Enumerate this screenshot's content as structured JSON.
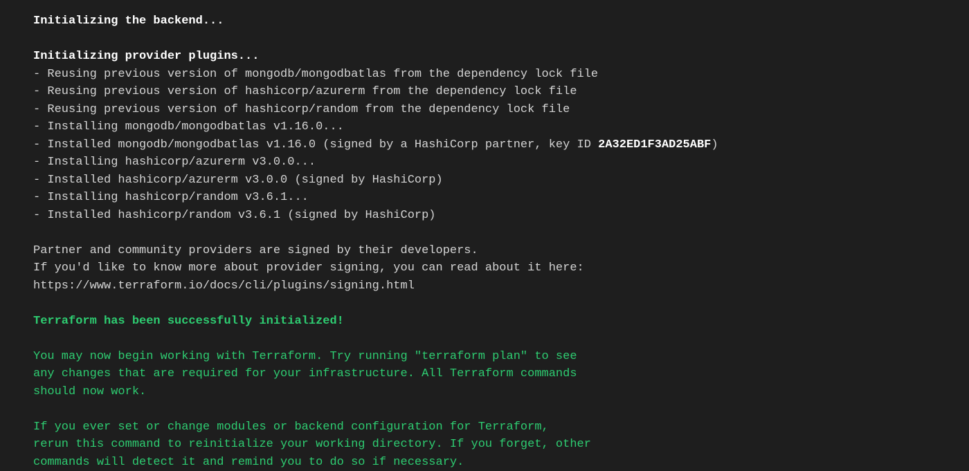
{
  "colors": {
    "success": "#2ecc71",
    "text": "#d4d4d4",
    "bg": "#1e1e1e"
  },
  "lines": {
    "init_backend": "Initializing the backend...",
    "init_plugins": "Initializing provider plugins...",
    "reuse_mongodb": "- Reusing previous version of mongodb/mongodbatlas from the dependency lock file",
    "reuse_azurerm": "- Reusing previous version of hashicorp/azurerm from the dependency lock file",
    "reuse_random": "- Reusing previous version of hashicorp/random from the dependency lock file",
    "install_mongodb": "- Installing mongodb/mongodbatlas v1.16.0...",
    "installed_mongodb_prefix": "- Installed mongodb/mongodbatlas v1.16.0 (signed by a HashiCorp partner, key ID ",
    "installed_mongodb_keyid": "2A32ED1F3AD25ABF",
    "installed_mongodb_suffix": ")",
    "install_azurerm": "- Installing hashicorp/azurerm v3.0.0...",
    "installed_azurerm": "- Installed hashicorp/azurerm v3.0.0 (signed by HashiCorp)",
    "install_random": "- Installing hashicorp/random v3.6.1...",
    "installed_random": "- Installed hashicorp/random v3.6.1 (signed by HashiCorp)",
    "partner1": "Partner and community providers are signed by their developers.",
    "partner2": "If you'd like to know more about provider signing, you can read about it here:",
    "partner3": "https://www.terraform.io/docs/cli/plugins/signing.html",
    "success": "Terraform has been successfully initialized!",
    "advice1": "You may now begin working with Terraform. Try running \"terraform plan\" to see",
    "advice2": "any changes that are required for your infrastructure. All Terraform commands",
    "advice3": "should now work.",
    "advice4": "If you ever set or change modules or backend configuration for Terraform,",
    "advice5": "rerun this command to reinitialize your working directory. If you forget, other",
    "advice6": "commands will detect it and remind you to do so if necessary."
  }
}
